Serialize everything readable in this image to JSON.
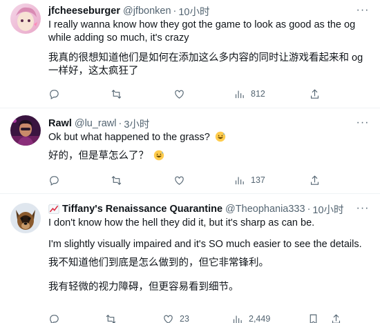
{
  "tweets": [
    {
      "name": "jfcheeseburger",
      "handle": "@jfbonken",
      "time": "10小时",
      "text_en": "I really wanna know how they got the game to look as good as the og while adding so much, it's crazy",
      "text_zh": "我真的很想知道他们是如何在添加这么多内容的同时让游戏看起来和 og 一样好，这太疯狂了",
      "views": "812"
    },
    {
      "name": "Rawl",
      "handle": "@lu_rawl",
      "time": "3小时",
      "text_en": "Ok but what happened to the grass?",
      "text_zh": "好的，但是草怎么了？",
      "views": "137"
    },
    {
      "name": "Tiffany's Renaissance Quarantine",
      "handle": "@Theophania333",
      "time": "10小时",
      "text_en_1": "I don't know how the hell they did it, but it's sharp as can be.",
      "text_en_2": "I'm slightly visually impaired and it's SO much easier to see the details.",
      "text_zh_1": "我不知道他们到底是怎么做到的，但它非常锋利。",
      "text_zh_2": "我有轻微的视力障碍，但更容易看到细节。",
      "likes": "23",
      "views": "2,449"
    }
  ],
  "dot": "·",
  "more": "···",
  "colors": {
    "text": "#0f1419",
    "muted": "#536471",
    "divider": "#eff3f4"
  },
  "icons": [
    "reply-icon",
    "retweet-icon",
    "like-icon",
    "views-icon",
    "bookmark-icon",
    "share-icon",
    "grinning-sweat-emoji",
    "chart-emoji"
  ]
}
